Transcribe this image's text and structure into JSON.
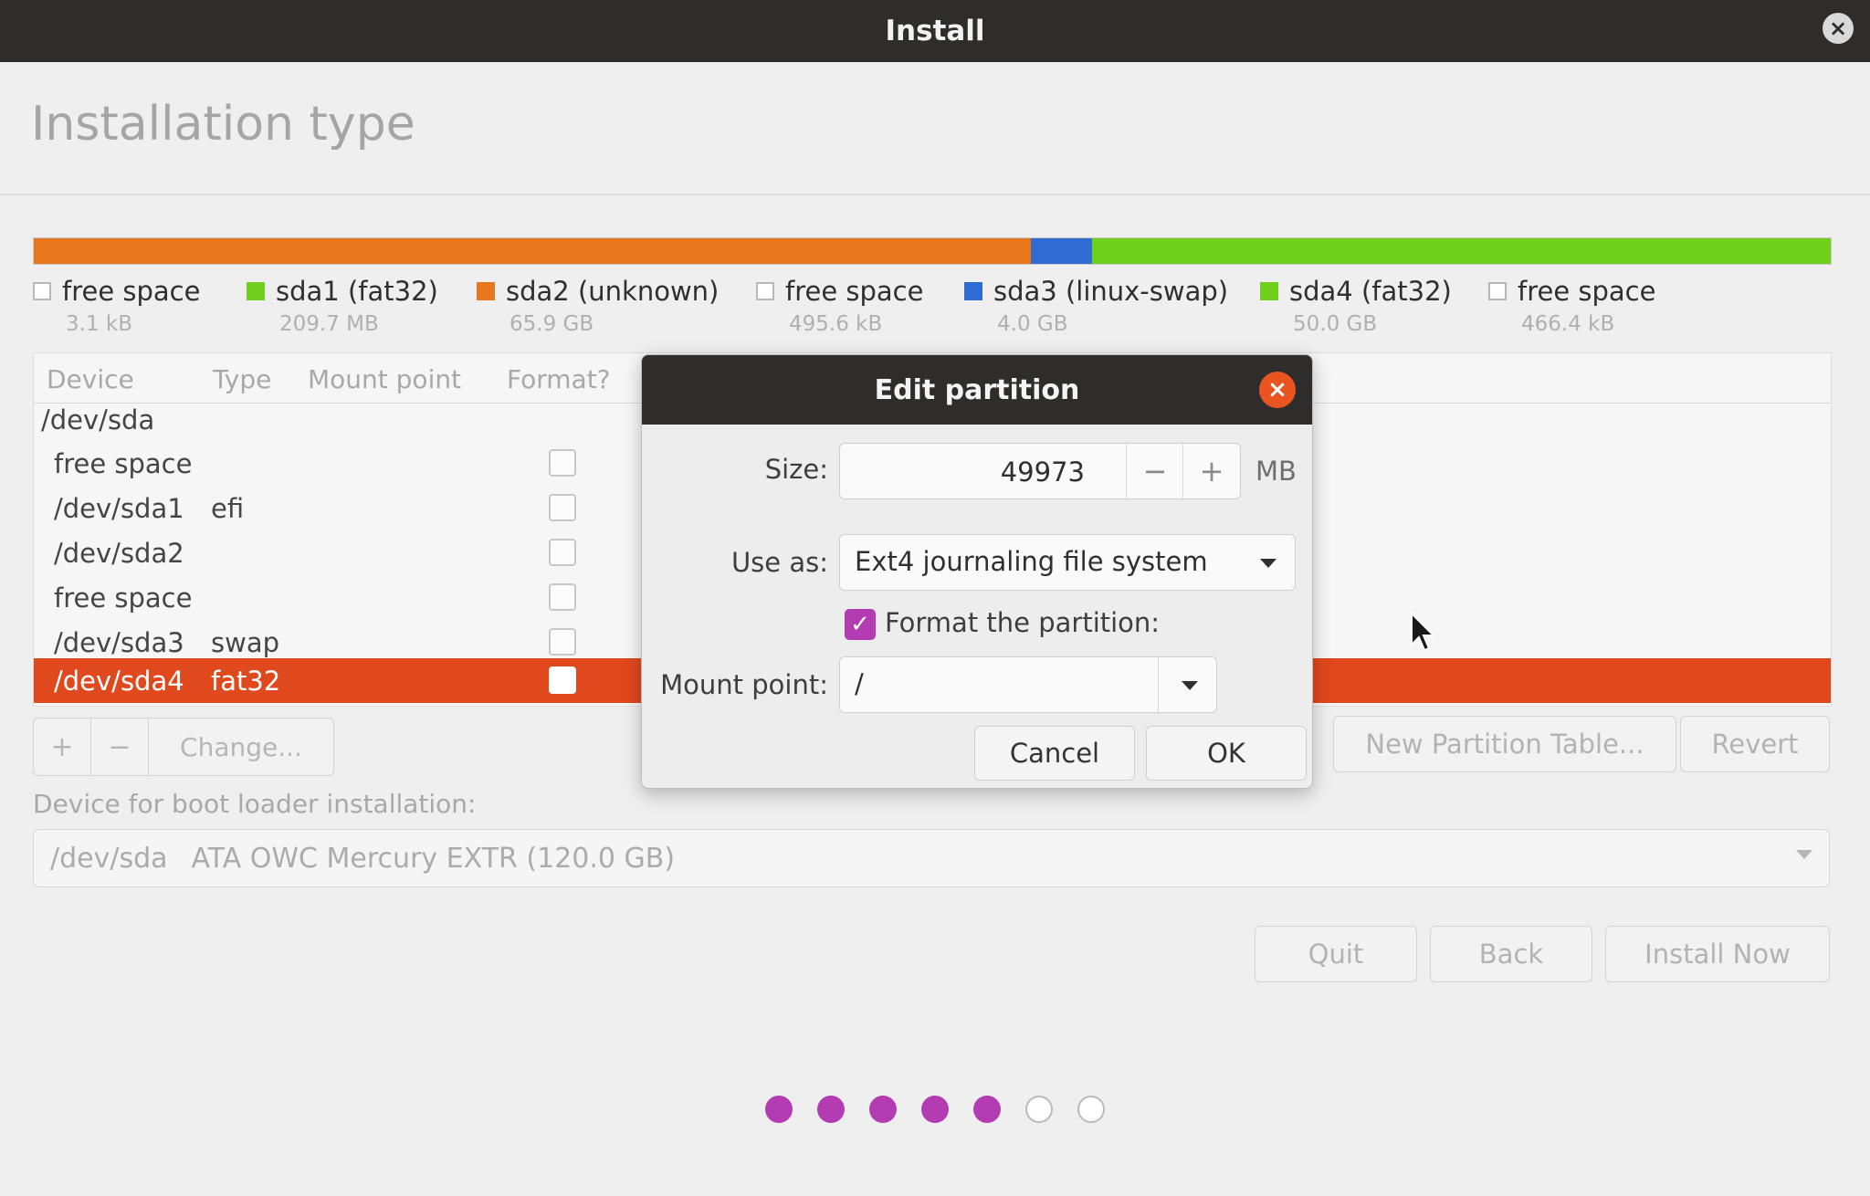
{
  "window": {
    "title": "Install",
    "close_icon": "×"
  },
  "page": {
    "title": "Installation type"
  },
  "partition_bar": {
    "segments": [
      {
        "label": "sda2 (unknown)",
        "color": "#e8771d",
        "fraction": 0.555
      },
      {
        "label": "sda3 (linux-swap)",
        "color": "#2f6bd3",
        "fraction": 0.034
      },
      {
        "label": "sda4 (fat32)",
        "color": "#6fcf1a",
        "fraction": 0.411
      }
    ]
  },
  "legend": [
    {
      "name": "free space",
      "size": "3.1 kB",
      "swatch": "#ffffff"
    },
    {
      "name": "sda1 (fat32)",
      "size": "209.7 MB",
      "swatch": "#6fcf1a"
    },
    {
      "name": "sda2 (unknown)",
      "size": "65.9 GB",
      "swatch": "#e8771d"
    },
    {
      "name": "free space",
      "size": "495.6 kB",
      "swatch": "#ffffff"
    },
    {
      "name": "sda3 (linux-swap)",
      "size": "4.0 GB",
      "swatch": "#2f6bd3"
    },
    {
      "name": "sda4 (fat32)",
      "size": "50.0 GB",
      "swatch": "#6fcf1a"
    },
    {
      "name": "free space",
      "size": "466.4 kB",
      "swatch": "#ffffff"
    }
  ],
  "table": {
    "headers": {
      "device": "Device",
      "type": "Type",
      "mount": "Mount point",
      "format": "Format?"
    },
    "rows": [
      {
        "device": "/dev/sda",
        "type": ""
      },
      {
        "device": "free space",
        "type": ""
      },
      {
        "device": "/dev/sda1",
        "type": "efi"
      },
      {
        "device": "/dev/sda2",
        "type": ""
      },
      {
        "device": "free space",
        "type": ""
      },
      {
        "device": "/dev/sda3",
        "type": "swap"
      },
      {
        "device": "/dev/sda4",
        "type": "fat32"
      }
    ]
  },
  "toolbar": {
    "add": "+",
    "remove": "−",
    "change": "Change..."
  },
  "actions": {
    "new_table": "New Partition Table...",
    "revert": "Revert"
  },
  "boot": {
    "label": "Device for boot loader installation:",
    "device": "/dev/sda",
    "name": "ATA OWC Mercury EXTR (120.0 GB)"
  },
  "nav": {
    "quit": "Quit",
    "back": "Back",
    "install": "Install Now"
  },
  "progress": {
    "total": 7,
    "completed": 5,
    "color": "#b43cb2"
  },
  "dialog": {
    "title": "Edit partition",
    "close_icon": "×",
    "size_label": "Size:",
    "size_value": "49973",
    "minus": "−",
    "plus": "+",
    "unit": "MB",
    "use_as_label": "Use as:",
    "use_as_value": "Ext4 journaling file system",
    "format_checked": true,
    "format_label": "Format the partition:",
    "mount_label": "Mount point:",
    "mount_value": "/",
    "cancel": "Cancel",
    "ok": "OK"
  }
}
